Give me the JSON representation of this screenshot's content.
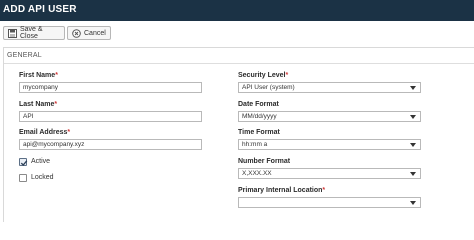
{
  "window": {
    "title": "ADD API USER"
  },
  "toolbar": {
    "save_label": "Save & Close",
    "cancel_label": "Cancel"
  },
  "section": {
    "title": "GENERAL"
  },
  "left": {
    "first_name": {
      "label": "First Name",
      "value": "mycompany",
      "required": "*"
    },
    "last_name": {
      "label": "Last Name",
      "value": "API",
      "required": "*"
    },
    "email": {
      "label": "Email Address",
      "value": "api@mycompany.xyz",
      "required": "*"
    },
    "active": {
      "label": "Active",
      "checked": true
    },
    "locked": {
      "label": "Locked",
      "checked": false
    }
  },
  "right": {
    "security_level": {
      "label": "Security Level",
      "value": "API User (system)",
      "required": "*"
    },
    "date_format": {
      "label": "Date Format",
      "value": "MM/dd/yyyy"
    },
    "time_format": {
      "label": "Time Format",
      "value": "hh:mm a"
    },
    "number_format": {
      "label": "Number Format",
      "value": "X,XXX.XX"
    },
    "primary_location": {
      "label": "Primary Internal Location",
      "value": "",
      "required": "*"
    }
  },
  "colors": {
    "titlebar": "#1b3245",
    "required": "#d03b3b"
  },
  "icons": {
    "save": "save-icon",
    "cancel": "cancel-icon",
    "dropdown": "chevron-down-icon"
  }
}
